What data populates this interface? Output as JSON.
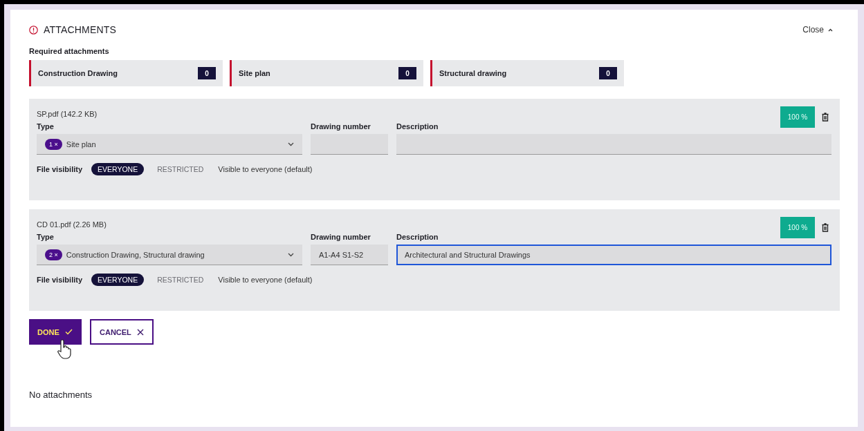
{
  "header": {
    "title": "ATTACHMENTS",
    "close": "Close"
  },
  "required": {
    "label": "Required attachments",
    "items": [
      {
        "label": "Construction Drawing",
        "count": "0"
      },
      {
        "label": "Site plan",
        "count": "0"
      },
      {
        "label": "Structural drawing",
        "count": "0"
      }
    ]
  },
  "files": [
    {
      "name": "SP.pdf (142.2 KB)",
      "progress": "100 %",
      "type_label": "Type",
      "type_count": "1",
      "chip_remove": "×",
      "type_value": "Site plan",
      "drawing_label": "Drawing number",
      "description_label": "Description",
      "focused": false,
      "visibility_label": "File visibility",
      "visibility_options": [
        {
          "label": "EVERYONE",
          "selected": true
        },
        {
          "label": "RESTRICTED",
          "selected": false
        }
      ],
      "visibility_note": "Visible to everyone (default)"
    },
    {
      "name": "CD 01.pdf (2.26 MB)",
      "progress": "100 %",
      "type_label": "Type",
      "type_count": "2",
      "chip_remove": "×",
      "type_value": "Construction Drawing, Structural drawing",
      "drawing_label": "Drawing number",
      "drawing_value": "A1-A4 S1-S2",
      "description_label": "Description",
      "description_value": "Architectural and Structural Drawings",
      "focused": true,
      "visibility_label": "File visibility",
      "visibility_options": [
        {
          "label": "EVERYONE",
          "selected": true
        },
        {
          "label": "RESTRICTED",
          "selected": false
        }
      ],
      "visibility_note": "Visible to everyone (default)"
    }
  ],
  "buttons": [
    {
      "label": "DONE",
      "kind": "primary"
    },
    {
      "label": "CANCEL",
      "kind": "secondary"
    }
  ],
  "empty_message": "No attachments"
}
